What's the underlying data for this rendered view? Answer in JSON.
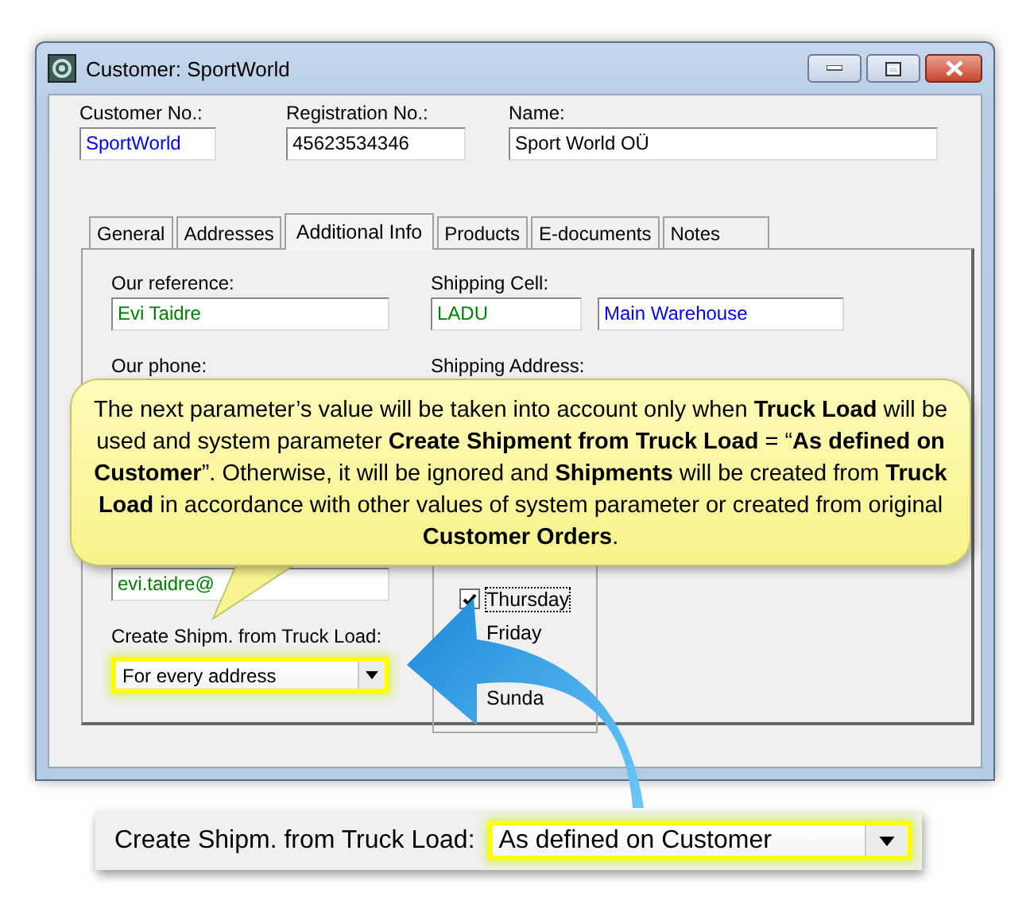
{
  "window": {
    "title": "Customer: SportWorld"
  },
  "header_fields": [
    {
      "label": "Customer No.:",
      "value": "SportWorld",
      "color": "#0000ff"
    },
    {
      "label": "Registration No.:",
      "value": "45623534346",
      "color": "#000000"
    },
    {
      "label": "Name:",
      "value": "Sport World OÜ",
      "color": "#000000"
    }
  ],
  "tabs": [
    {
      "label": "General",
      "selected": false
    },
    {
      "label": "Addresses",
      "selected": false
    },
    {
      "label": "Additional Info",
      "selected": true
    },
    {
      "label": "Products",
      "selected": false
    },
    {
      "label": "E-documents",
      "selected": false
    },
    {
      "label": "Notes",
      "selected": false
    }
  ],
  "tab_content": {
    "fields": [
      {
        "label": "Our reference:",
        "values": [
          {
            "text": "Evi Taidre",
            "color": "#008000"
          }
        ]
      },
      {
        "label": "Shipping Cell:",
        "values": [
          {
            "text": "LADU",
            "color": "#008000"
          },
          {
            "text": "Main Warehouse",
            "color": "#0000ff"
          }
        ]
      }
    ],
    "partly_covered_labels": [
      "Our phone:",
      "Shipping Address:"
    ],
    "email": {
      "value": "evi.taidre@",
      "color": "#008000"
    },
    "shipment_combo": {
      "label": "Create Shipm. from Truck Load:",
      "value": "For every address",
      "highlighted": true
    },
    "loading_days": [
      {
        "label": "Thursday",
        "checked": true
      },
      {
        "label": "Friday"
      },
      {
        "label": "Sunda"
      }
    ]
  },
  "callout": {
    "text": "The next parameter’s value will be taken into account only when **Truck Load** will be used and system parameter **Create Shipment from Truck Load** = “**As defined on Customer**”.  Otherwise, it will be ignored and **Shipments** will be created from **Truck Load** in accordance with other values of system parameter or created from original **Customer Orders**."
  },
  "bottom_strip": {
    "label": "Create Shipm. from Truck Load:",
    "value": "As defined on Customer",
    "highlighted": true
  }
}
